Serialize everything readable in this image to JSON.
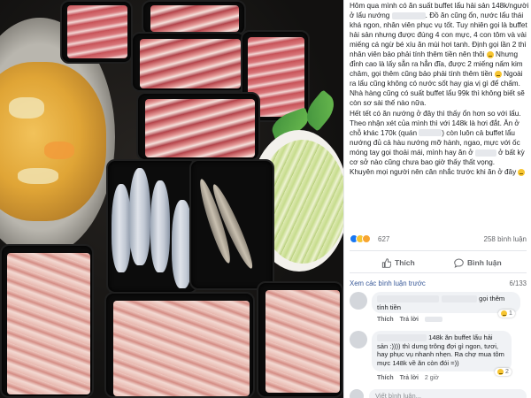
{
  "post": {
    "paragraphs": [
      {
        "id": "p1",
        "parts": [
          "Hôm qua mình có ăn suất buffet lẩu hải sản 148k/người ở lẩu nướng ",
          "[redacted]",
          ". Đồ ăn cũng ổn, nước lẩu thái khá ngon, nhân viên phục vụ tốt. Tuy nhiên gọi là buffet hải sản nhưng được đúng 4 con mực, 4 con tôm và vài miếng cá ngừ bé xíu ăn mùi hơi tanh. Định gọi lần 2 thì nhân viên bảo phải tính thêm tiền nên thôi ",
          "[emoji]",
          " Nhưng đỉnh cao là lấy sẵn ra hẳn đĩa, được 2 miếng nấm kim châm, gọi thêm cũng bảo phải tính thêm tiền ",
          "[emoji]",
          " Ngoài ra lẩu cũng không có nước sốt hay gia vị gì để chấm. Nhà hàng cũng có suất buffet lẩu 99k thì không biết sẽ còn sơ sài thế nào nữa."
        ]
      },
      {
        "id": "p2",
        "parts": [
          "Hết tết có ăn nướng ở đây thì thấy ổn hơn so với lẩu."
        ]
      },
      {
        "id": "p3",
        "parts": [
          "Theo nhận xét của mình thì với 148k là hơi đắt. Ăn ở chỗ khác 170k (quán ",
          "[redacted]",
          ") còn luôn cả buffet lẩu nướng đủ cả hàu nướng mỡ hành, ngao, mực với ốc móng tay gọi thoải mái, mình hay ăn ở ",
          "[redacted]",
          " ở bất kỳ cơ sở nào cũng chưa bao giờ thấy thất vọng."
        ]
      },
      {
        "id": "p4",
        "parts": [
          "Khuyên mọi người nên cân nhắc trước khi ăn ở đây ",
          "[emoji]"
        ]
      }
    ]
  },
  "reactions": {
    "count": "627",
    "comments": "258 bình luận"
  },
  "actions": {
    "like": "Thích",
    "comment": "Bình luận"
  },
  "more_comments": {
    "label": "Xem các bình luận trước",
    "pager": "6/133"
  },
  "comments": [
    {
      "text": "gọi thêm tính tiền",
      "meta_like": "Thích",
      "meta_reply": "Trả lời",
      "react_count": "1"
    },
    {
      "text_lines": [
        "148k ăn buffet lẩu hải",
        "sản :))))  thì dưng trông đợi gì ngon, tươi,",
        "hay phục vụ nhanh nhẹn. Ra chợ mua tôm",
        "mực 148k về ăn còn đói =))"
      ],
      "meta_like": "Thích",
      "meta_reply": "Trả lời",
      "meta_time": "2 giờ",
      "react_count": "2"
    }
  ],
  "comment_input": {
    "placeholder": "Viết bình luận..."
  },
  "colors": {
    "link": "#385898",
    "secondary_text": "#65676b",
    "like_blue": "#1877f2"
  }
}
